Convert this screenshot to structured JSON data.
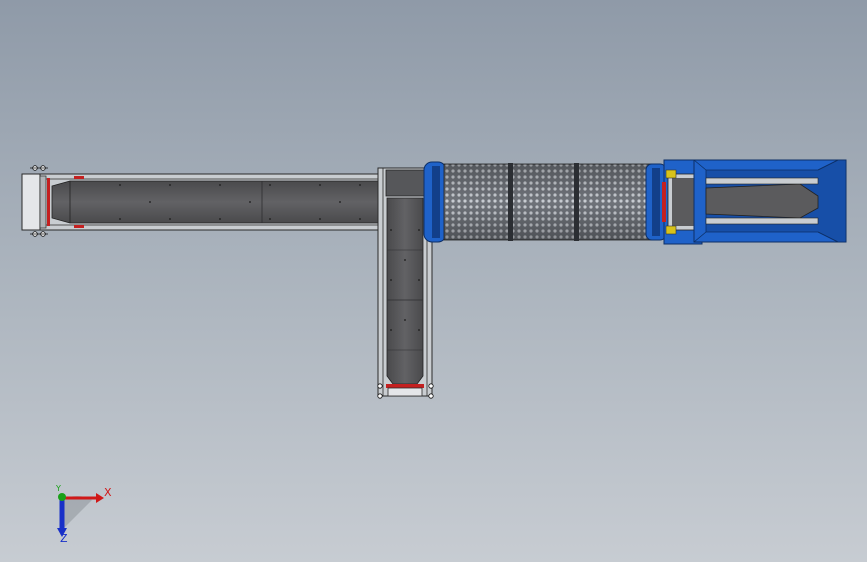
{
  "viewport": {
    "background_top": "#8f9aa8",
    "background_bottom": "#c7ccd2"
  },
  "model": {
    "components": [
      {
        "id": "left-belt-conveyor",
        "kind": "belt-conveyor",
        "orientation": "horizontal"
      },
      {
        "id": "vertical-belt-conveyor",
        "kind": "belt-conveyor",
        "orientation": "vertical"
      },
      {
        "id": "rotary-drum-screen",
        "kind": "trommel-drum",
        "segments": 3
      },
      {
        "id": "feed-hopper",
        "kind": "hopper"
      }
    ],
    "colors": {
      "belt": "#5b5b5d",
      "belt_dark": "#3e3e40",
      "frame": "#c9cdd1",
      "frame_edge": "#2a2a2a",
      "drum_blue": "#1f62c9",
      "drum_blue_dark": "#123f8a",
      "accent_red": "#c42020",
      "accent_yellow": "#d8c21a"
    }
  },
  "triad": {
    "x_label": "X",
    "y_label": "Y",
    "z_label": "Z",
    "x_color": "#d01818",
    "y_color": "#18a018",
    "z_color": "#1830c8"
  }
}
